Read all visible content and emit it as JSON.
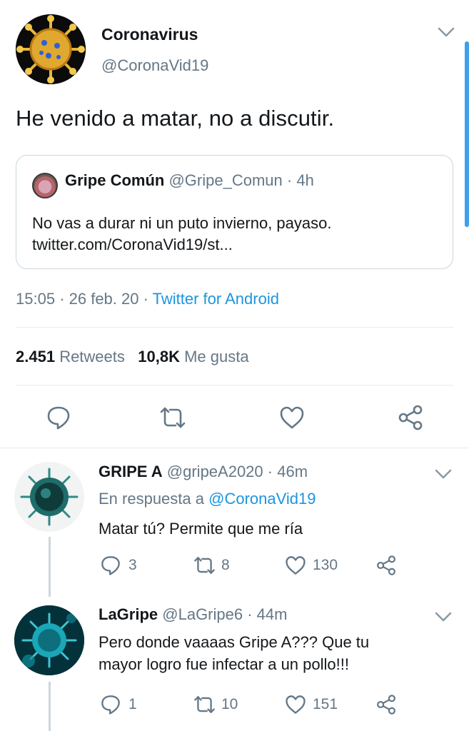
{
  "main_tweet": {
    "author_name": "Coronavirus",
    "author_handle": "@CoronaVid19",
    "text": "He venido a matar, no a discutir.",
    "quoted": {
      "name": "Gripe Común",
      "handle": "@Gripe_Comun",
      "time": "· 4h",
      "text_line1": "No vas a durar ni un puto invierno, payaso.",
      "text_line2": "twitter.com/CoronaVid19/st..."
    },
    "time": "15:05",
    "date": "· 26 feb. 20 ·",
    "source": "Twitter for Android",
    "retweets_count": "2.451",
    "retweets_label": "Retweets",
    "likes_count": "10,8K",
    "likes_label": "Me gusta"
  },
  "replies": [
    {
      "name": "GRIPE A",
      "handle": "@gripeA2020",
      "time": "· 46m",
      "reply_to_label": "En respuesta a",
      "reply_to_handle": "@CoronaVid19",
      "text": "Matar tú? Permite que me ría",
      "reply_count": "3",
      "retweet_count": "8",
      "like_count": "130"
    },
    {
      "name": "LaGripe",
      "handle": "@LaGripe6",
      "time": "· 44m",
      "text_line1": "Pero donde vaaaas Gripe A??? Que tu",
      "text_line2": "mayor logro fue infectar a un pollo!!!",
      "reply_count": "1",
      "retweet_count": "10",
      "like_count": "151"
    }
  ],
  "colors": {
    "link": "#1b95e0",
    "muted": "#657786",
    "divider": "#e6ecf0"
  },
  "icons": [
    "chevron-down-icon",
    "reply-icon",
    "retweet-icon",
    "like-icon",
    "share-icon"
  ]
}
